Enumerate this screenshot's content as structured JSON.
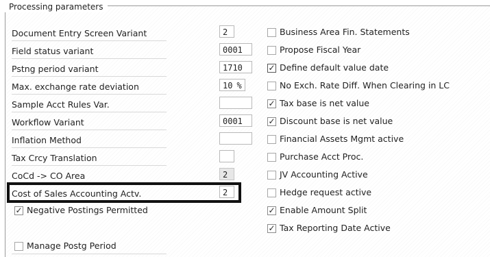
{
  "group": {
    "title": "Processing parameters"
  },
  "rows": [
    {
      "label": "Document Entry Screen Variant",
      "value": "2",
      "unit": "",
      "readonly": false,
      "field_width": "narrow"
    },
    {
      "label": "Field status variant",
      "value": "0001",
      "unit": "",
      "readonly": false,
      "field_width": "wide"
    },
    {
      "label": "Pstng period variant",
      "value": "1710",
      "unit": "",
      "readonly": false,
      "field_width": "wide"
    },
    {
      "label": "Max. exchange rate deviation",
      "value": "10",
      "unit": "%",
      "readonly": false,
      "field_width": "wide"
    },
    {
      "label": "Sample Acct Rules Var.",
      "value": "",
      "unit": "",
      "readonly": false,
      "field_width": "wide"
    },
    {
      "label": "Workflow Variant",
      "value": "0001",
      "unit": "",
      "readonly": false,
      "field_width": "wide"
    },
    {
      "label": "Inflation Method",
      "value": "",
      "unit": "",
      "readonly": false,
      "field_width": "wide"
    },
    {
      "label": "Tax Crcy Translation",
      "value": "",
      "unit": "",
      "readonly": false,
      "field_width": "narrow"
    },
    {
      "label": "CoCd -> CO Area",
      "value": "2",
      "unit": "",
      "readonly": true,
      "field_width": "narrow"
    },
    {
      "label": "Cost of Sales Accounting Actv.",
      "value": "2",
      "unit": "",
      "readonly": false,
      "field_width": "narrow"
    }
  ],
  "left_checkboxes": [
    {
      "label": "Negative Postings Permitted",
      "checked": true
    },
    {
      "label": "Manage Postg Period",
      "checked": false
    }
  ],
  "right_checkboxes": [
    {
      "label": "Business Area Fin. Statements",
      "checked": false
    },
    {
      "label": "Propose Fiscal Year",
      "checked": false
    },
    {
      "label": "Define default value date",
      "checked": true,
      "emphasis": true
    },
    {
      "label": "No Exch. Rate Diff. When Clearing in LC",
      "checked": false
    },
    {
      "label": "Tax base is net value",
      "checked": true
    },
    {
      "label": "Discount base is net value",
      "checked": true
    },
    {
      "label": "Financial Assets Mgmt active",
      "checked": false
    },
    {
      "label": "Purchase Acct Proc.",
      "checked": false
    },
    {
      "label": "JV Accounting Active",
      "checked": false
    },
    {
      "label": "Hedge request active",
      "checked": false
    },
    {
      "label": "Enable Amount Split",
      "checked": true
    },
    {
      "label": "Tax Reporting Date Active",
      "checked": true
    }
  ]
}
